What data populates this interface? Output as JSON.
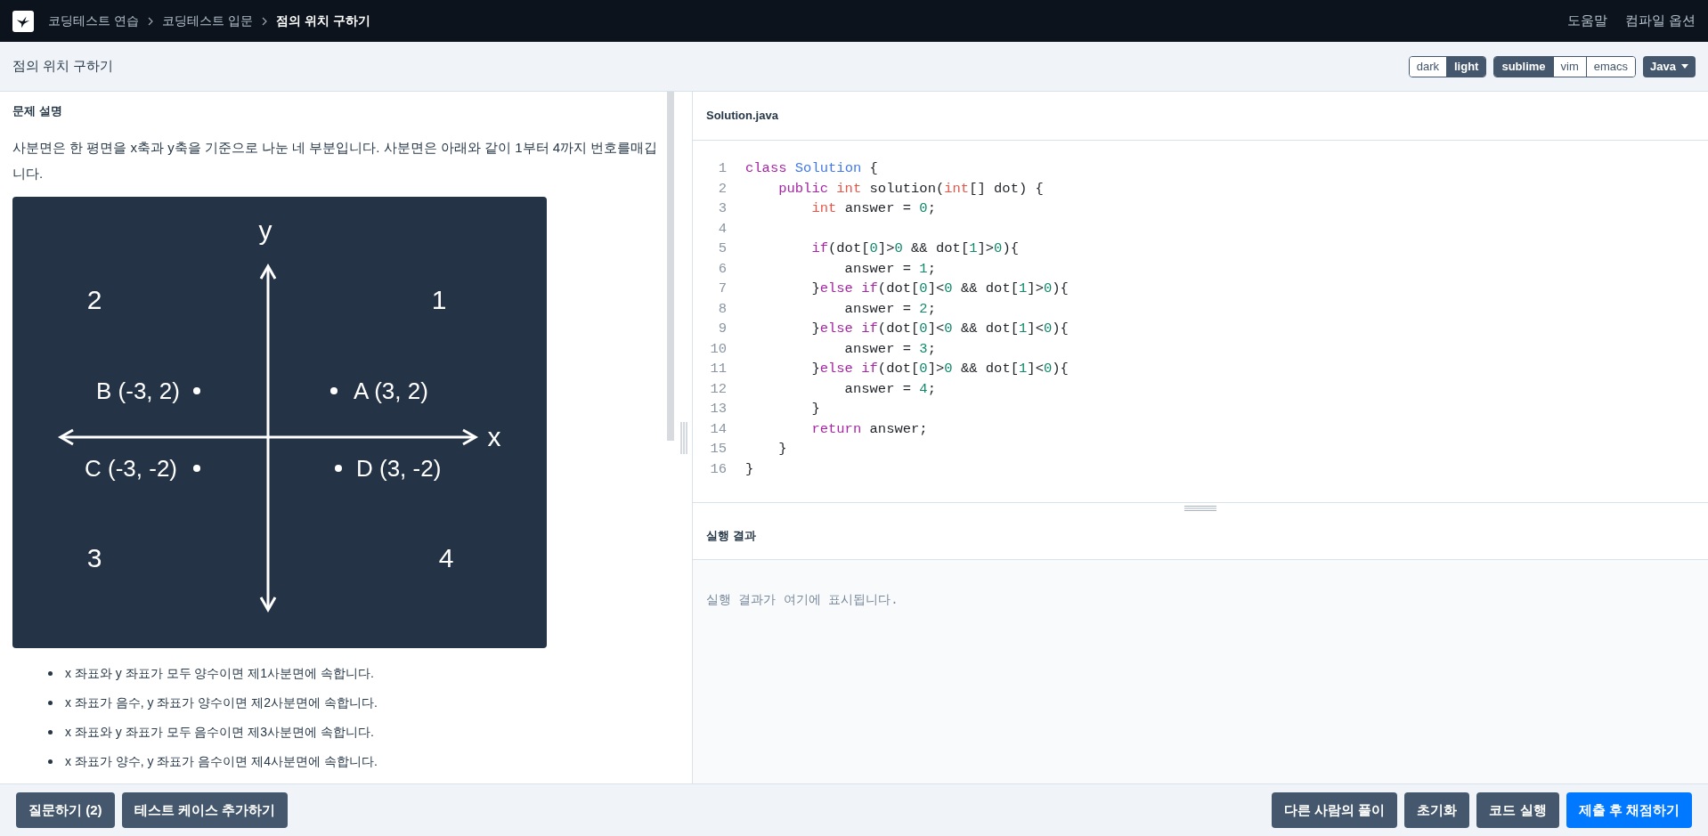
{
  "nav": {
    "breadcrumbs": [
      {
        "label": "코딩테스트 연습",
        "current": false
      },
      {
        "label": "코딩테스트 입문",
        "current": false
      },
      {
        "label": "점의 위치 구하기",
        "current": true
      }
    ],
    "links": [
      "도움말",
      "컴파일 옵션"
    ]
  },
  "header": {
    "title": "점의 위치 구하기",
    "themes": [
      {
        "label": "dark",
        "selected": false
      },
      {
        "label": "light",
        "selected": true
      }
    ],
    "keymaps": [
      {
        "label": "sublime",
        "selected": true
      },
      {
        "label": "vim",
        "selected": false
      },
      {
        "label": "emacs",
        "selected": false
      }
    ],
    "language": "Java"
  },
  "problem": {
    "heading": "문제 설명",
    "intro": "사분면은 한 평면을 x축과 y축을 기준으로 나눈 네 부분입니다. 사분면은 아래와 같이 1부터 4까지 번호를매깁니다.",
    "figure": {
      "axis_labels": [
        "y",
        "x"
      ],
      "quadrant_numbers": [
        "2",
        "1",
        "3",
        "4"
      ],
      "points": [
        "B (-3, 2)",
        "A (3, 2)",
        "C (-3, -2)",
        "D (3, -2)"
      ]
    },
    "bullets": [
      "x 좌표와 y 좌표가 모두 양수이면 제1사분면에 속합니다.",
      "x 좌표가 음수, y 좌표가 양수이면 제2사분면에 속합니다.",
      "x 좌표와 y 좌표가 모두 음수이면 제3사분면에 속합니다.",
      "x 좌표가 양수, y 좌표가 음수이면 제4사분면에 속합니다."
    ]
  },
  "editor": {
    "filename": "Solution.java",
    "lines": [
      {
        "number": "1",
        "tokens": [
          {
            "kind": "keyword",
            "text": "class"
          },
          {
            "kind": "class",
            "text": " Solution"
          },
          {
            "kind": "plain",
            "text": " {"
          }
        ]
      },
      {
        "number": "2",
        "tokens": [
          {
            "kind": "keyword",
            "text": "    public"
          },
          {
            "kind": "type",
            "text": " int"
          },
          {
            "kind": "plain",
            "text": " solution("
          },
          {
            "kind": "type",
            "text": "int"
          },
          {
            "kind": "plain",
            "text": "[] dot) {"
          }
        ]
      },
      {
        "number": "3",
        "tokens": [
          {
            "kind": "type",
            "text": "        int"
          },
          {
            "kind": "plain",
            "text": " answer = "
          },
          {
            "kind": "number",
            "text": "0"
          },
          {
            "kind": "plain",
            "text": ";"
          }
        ]
      },
      {
        "number": "4"
      },
      {
        "number": "5",
        "tokens": [
          {
            "kind": "keyword",
            "text": "        if"
          },
          {
            "kind": "plain",
            "text": "(dot["
          },
          {
            "kind": "number",
            "text": "0"
          },
          {
            "kind": "plain",
            "text": "]>"
          },
          {
            "kind": "number",
            "text": "0"
          },
          {
            "kind": "plain",
            "text": " && dot["
          },
          {
            "kind": "number",
            "text": "1"
          },
          {
            "kind": "plain",
            "text": "]>"
          },
          {
            "kind": "number",
            "text": "0"
          },
          {
            "kind": "plain",
            "text": "){"
          }
        ]
      },
      {
        "number": "6",
        "tokens": [
          {
            "kind": "plain",
            "text": "            answer = "
          },
          {
            "kind": "number",
            "text": "1"
          },
          {
            "kind": "plain",
            "text": ";"
          }
        ]
      },
      {
        "number": "7",
        "tokens": [
          {
            "kind": "plain",
            "text": "        }"
          },
          {
            "kind": "keyword",
            "text": "else if"
          },
          {
            "kind": "plain",
            "text": "(dot["
          },
          {
            "kind": "number",
            "text": "0"
          },
          {
            "kind": "plain",
            "text": "]<"
          },
          {
            "kind": "number",
            "text": "0"
          },
          {
            "kind": "plain",
            "text": " && dot["
          },
          {
            "kind": "number",
            "text": "1"
          },
          {
            "kind": "plain",
            "text": "]>"
          },
          {
            "kind": "number",
            "text": "0"
          },
          {
            "kind": "plain",
            "text": "){"
          }
        ]
      },
      {
        "number": "8",
        "tokens": [
          {
            "kind": "plain",
            "text": "            answer = "
          },
          {
            "kind": "number",
            "text": "2"
          },
          {
            "kind": "plain",
            "text": ";"
          }
        ]
      },
      {
        "number": "9",
        "tokens": [
          {
            "kind": "plain",
            "text": "        }"
          },
          {
            "kind": "keyword",
            "text": "else if"
          },
          {
            "kind": "plain",
            "text": "(dot["
          },
          {
            "kind": "number",
            "text": "0"
          },
          {
            "kind": "plain",
            "text": "]<"
          },
          {
            "kind": "number",
            "text": "0"
          },
          {
            "kind": "plain",
            "text": " && dot["
          },
          {
            "kind": "number",
            "text": "1"
          },
          {
            "kind": "plain",
            "text": "]<"
          },
          {
            "kind": "number",
            "text": "0"
          },
          {
            "kind": "plain",
            "text": "){"
          }
        ]
      },
      {
        "number": "10",
        "tokens": [
          {
            "kind": "plain",
            "text": "            answer = "
          },
          {
            "kind": "number",
            "text": "3"
          },
          {
            "kind": "plain",
            "text": ";"
          }
        ]
      },
      {
        "number": "11",
        "tokens": [
          {
            "kind": "plain",
            "text": "        }"
          },
          {
            "kind": "keyword",
            "text": "else if"
          },
          {
            "kind": "plain",
            "text": "(dot["
          },
          {
            "kind": "number",
            "text": "0"
          },
          {
            "kind": "plain",
            "text": "]>"
          },
          {
            "kind": "number",
            "text": "0"
          },
          {
            "kind": "plain",
            "text": " && dot["
          },
          {
            "kind": "number",
            "text": "1"
          },
          {
            "kind": "plain",
            "text": "]<"
          },
          {
            "kind": "number",
            "text": "0"
          },
          {
            "kind": "plain",
            "text": "){"
          }
        ]
      },
      {
        "number": "12",
        "tokens": [
          {
            "kind": "plain",
            "text": "            answer = "
          },
          {
            "kind": "number",
            "text": "4"
          },
          {
            "kind": "plain",
            "text": ";"
          }
        ]
      },
      {
        "number": "13",
        "tokens": [
          {
            "kind": "plain",
            "text": "        }"
          }
        ]
      },
      {
        "number": "14",
        "tokens": [
          {
            "kind": "keyword",
            "text": "        return"
          },
          {
            "kind": "plain",
            "text": " answer;"
          }
        ]
      },
      {
        "number": "15",
        "tokens": [
          {
            "kind": "plain",
            "text": "    }"
          }
        ]
      },
      {
        "number": "16",
        "tokens": [
          {
            "kind": "plain",
            "text": "}"
          }
        ]
      }
    ]
  },
  "result": {
    "heading": "실행 결과",
    "message": "실행 결과가 여기에 표시됩니다."
  },
  "footer": {
    "left_buttons": [
      "질문하기 (2)",
      "테스트 케이스 추가하기"
    ],
    "right_buttons": [
      {
        "label": "다른 사람의 풀이",
        "kind": "secondary"
      },
      {
        "label": "초기화",
        "kind": "secondary"
      },
      {
        "label": "코드 실행",
        "kind": "secondary"
      },
      {
        "label": "제출 후 채점하기",
        "kind": "primary"
      }
    ]
  }
}
